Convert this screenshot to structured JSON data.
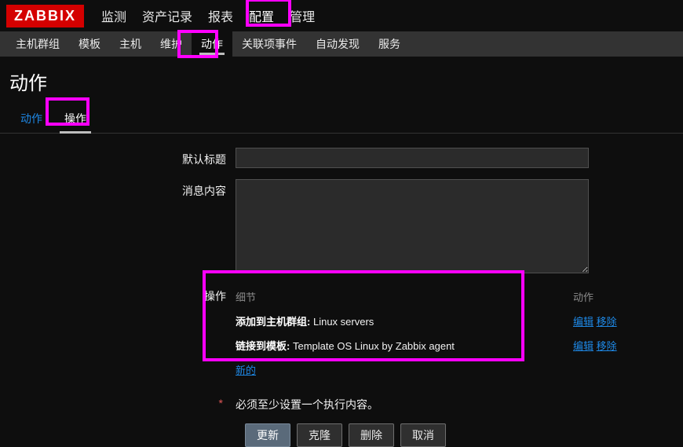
{
  "logo": "ZABBIX",
  "topnav": [
    "监测",
    "资产记录",
    "报表",
    "配置",
    "管理"
  ],
  "topnav_active": 3,
  "subnav": [
    "主机群组",
    "模板",
    "主机",
    "维护",
    "动作",
    "关联项事件",
    "自动发现",
    "服务"
  ],
  "subnav_active": 4,
  "page_title": "动作",
  "tabs": [
    {
      "label": "动作",
      "active": false
    },
    {
      "label": "操作",
      "active": true
    }
  ],
  "form": {
    "subject_label": "默认标题",
    "subject_value": "",
    "message_label": "消息内容",
    "message_value": "",
    "ops_label": "操作",
    "ops_head_detail": "细节",
    "ops_head_action": "动作",
    "ops_rows": [
      {
        "bold": "添加到主机群组",
        "value": "Linux servers",
        "edit": "编辑",
        "remove": "移除"
      },
      {
        "bold": "链接到模板",
        "value": "Template OS Linux by Zabbix agent",
        "edit": "编辑",
        "remove": "移除"
      }
    ],
    "new_link": "新的",
    "required_note": "必须至少设置一个执行内容。"
  },
  "buttons": {
    "update": "更新",
    "clone": "克隆",
    "delete": "删除",
    "cancel": "取消"
  }
}
